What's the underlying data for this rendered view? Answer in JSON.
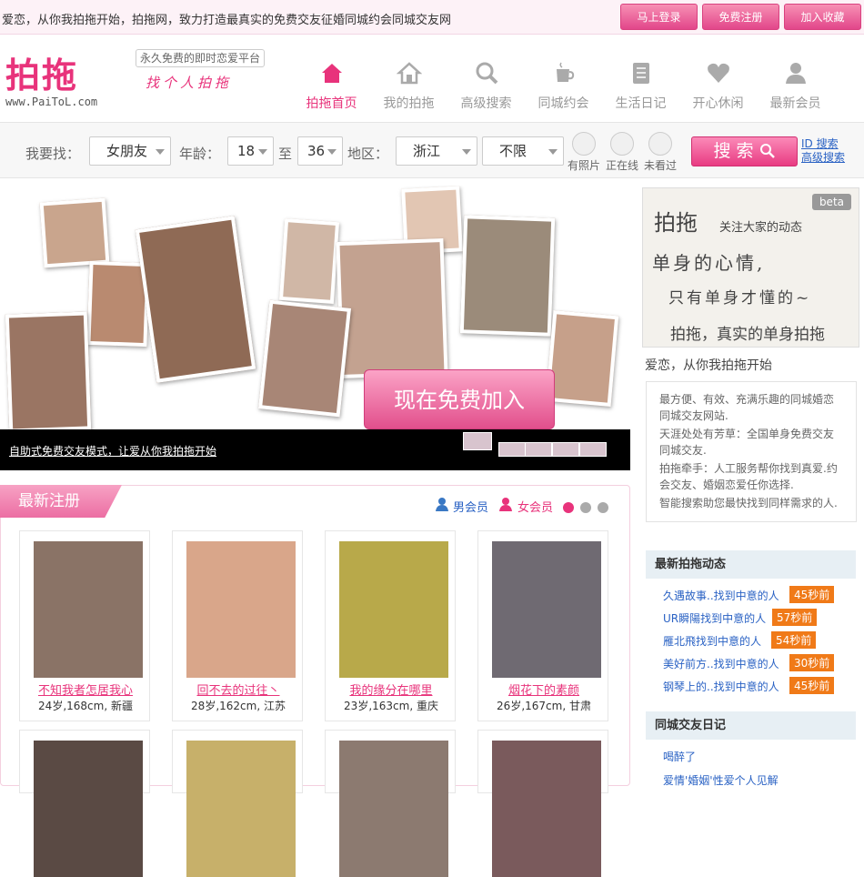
{
  "topbar": {
    "slogan": "爱恋，从你我拍拖开始，拍拖网，致力打造最真实的免费交友征婚同城约会同城交友网",
    "buttons": [
      "马上登录",
      "免费注册",
      "加入收藏"
    ]
  },
  "header": {
    "logo_text": "拍拖",
    "logo_url": "www.PaiToL.com",
    "tag_box": "永久免费的即时恋爱平台",
    "tagline": "找个人拍拖",
    "nav": [
      {
        "label": "拍拖首页",
        "icon": "home-icon",
        "active": true
      },
      {
        "label": "我的拍拖",
        "icon": "house-icon",
        "active": false
      },
      {
        "label": "高级搜索",
        "icon": "search-icon",
        "active": false
      },
      {
        "label": "同城约会",
        "icon": "coffee-cup-icon",
        "active": false
      },
      {
        "label": "生活日记",
        "icon": "notebook-icon",
        "active": false
      },
      {
        "label": "开心休闲",
        "icon": "heart-icon",
        "active": false
      },
      {
        "label": "最新会员",
        "icon": "user-icon",
        "active": false
      }
    ]
  },
  "search": {
    "find_label": "我要找：",
    "find_value": "女朋友",
    "age_label": "年龄：",
    "age_from": "18",
    "to_label": "至",
    "age_to": "36",
    "area_label": "地区：",
    "province": "浙江",
    "city": "不限",
    "checks": [
      "有照片",
      "正在线",
      "未看过"
    ],
    "button": "搜索",
    "id_search": "ID 搜索",
    "advanced": "高级搜索"
  },
  "banner": {
    "join_button": "现在免费加入",
    "caption": "自助式免费交友模式，让爱从你我拍拖开始"
  },
  "newest": {
    "tab": "最新注册",
    "male": "男会员",
    "female": "女会员",
    "members": [
      {
        "name": "不知我者怎居我心",
        "info": "24岁,168cm, 新疆"
      },
      {
        "name": "回不去的过往丶",
        "info": "28岁,162cm, 江苏"
      },
      {
        "name": "我的缘分在哪里",
        "info": "23岁,163cm, 重庆"
      },
      {
        "name": "烟花下的素颜",
        "info": "26岁,167cm, 甘肃"
      }
    ]
  },
  "sidebar": {
    "brand": "拍拖",
    "brand_sub": "关注大家的动态",
    "line1": "单身的心情,",
    "line2": "只有单身才懂的~",
    "line3": "拍拖，真实的单身拍拖",
    "beta": "beta",
    "title": "爱恋，从你我拍拖开始",
    "intro": [
      "最方便、有效、充满乐趣的同城婚恋同城交友网站.",
      "天涯处处有芳草：全国单身免费交友同城交友.",
      "拍拖牵手：人工服务帮你找到真爱.约会交友、婚姻恋爱任你选择.",
      "智能搜索助您最快找到同样需求的人."
    ],
    "activity_title": "最新拍拖动态",
    "activities": [
      {
        "text": "久遇故事..找到中意的人",
        "ago": "45秒前"
      },
      {
        "text": "UR瞬陽找到中意的人",
        "ago": "57秒前"
      },
      {
        "text": "雁北飛找到中意的人",
        "ago": "54秒前"
      },
      {
        "text": "美好前方..找到中意的人",
        "ago": "30秒前"
      },
      {
        "text": "钢琴上的..找到中意的人",
        "ago": "45秒前"
      }
    ],
    "diary_title": "同城交友日记",
    "diaries": [
      "喝醉了",
      "爱情'婚姻'性爱个人见解"
    ]
  }
}
